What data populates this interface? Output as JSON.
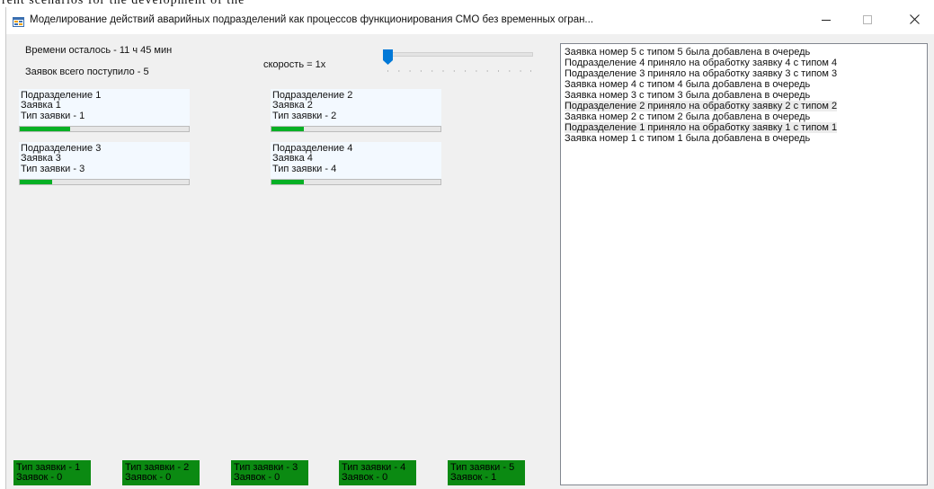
{
  "document": {
    "text_above_window": "rent  scenarios  for  the  development  of  the"
  },
  "window": {
    "title": "Моделирование действий аварийных подразделений как процессов функционирования СМО без временных огран...",
    "icon": "app-form-icon",
    "controls": {
      "minimize_icon": "minimize-icon",
      "maximize_icon": "maximize-icon",
      "close_icon": "close-icon"
    }
  },
  "status": {
    "time_left": "Времени осталось - 11 ч 45 мин",
    "requests_total": "Заявок всего поступило - 5",
    "speed_label": "скорость = 1x",
    "speed_slider_value": 0
  },
  "units": [
    {
      "name": "Подразделение 1",
      "request": "Заявка 1",
      "type": "Тип заявки - 1",
      "progress": 0.3
    },
    {
      "name": "Подразделение 2",
      "request": "Заявка 2",
      "type": "Тип заявки - 2",
      "progress": 0.19
    },
    {
      "name": "Подразделение 3",
      "request": "Заявка 3",
      "type": "Тип заявки - 3",
      "progress": 0.19
    },
    {
      "name": "Подразделение 4",
      "request": "Заявка 4",
      "type": "Тип заявки - 4",
      "progress": 0.19
    }
  ],
  "log": [
    "Заявка номер 5 с типом 5 была добавлена в очередь",
    "Подразделение 4 приняло на обработку заявку 4 с типом 4",
    "Подразделение 3 приняло на обработку заявку 3 с типом 3",
    "Заявка номер 4 с типом 4 была добавлена в очередь",
    "Заявка номер 3 с типом 3 была добавлена в очередь",
    "Подразделение 2 приняло на обработку заявку 2 с типом 2",
    "Заявка номер 2 с типом 2 была добавлена в очередь",
    "Подразделение 1 приняло на обработку заявку 1 с типом 1",
    "Заявка номер 1 с типом 1 была добавлена в очередь"
  ],
  "queues": [
    {
      "type": "Тип заявки - 1",
      "count": "Заявок - 0"
    },
    {
      "type": "Тип заявки - 2",
      "count": "Заявок - 0"
    },
    {
      "type": "Тип заявки - 3",
      "count": "Заявок - 0"
    },
    {
      "type": "Тип заявки - 4",
      "count": "Заявок - 0"
    },
    {
      "type": "Тип заявки - 5",
      "count": "Заявок - 1"
    }
  ],
  "colors": {
    "progress_fill": "#06b025",
    "queue_bg": "#0b8a12",
    "unit_bg": "#f3f9ff",
    "slider_thumb": "#0078d7"
  }
}
